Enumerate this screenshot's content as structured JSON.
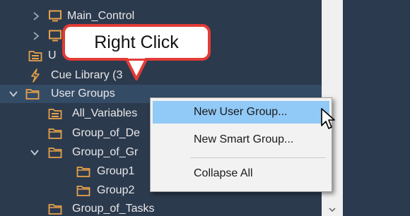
{
  "tree": {
    "items": [
      {
        "label": "Main_Control",
        "icon": "monitor-icon"
      },
      {
        "label": "",
        "icon": "monitor-icon"
      },
      {
        "label": "U",
        "icon": "variables-folder-icon"
      },
      {
        "label": "Cue Library (3",
        "icon": "lightning-icon"
      },
      {
        "label": "User Groups",
        "icon": "folder-icon"
      },
      {
        "label": "All_Variables",
        "icon": "variables-folder-icon"
      },
      {
        "label": "Group_of_De",
        "icon": "folder-icon"
      },
      {
        "label": "Group_of_Gr",
        "icon": "folder-icon"
      },
      {
        "label": "Group1",
        "icon": "folder-icon"
      },
      {
        "label": "Group2",
        "icon": "folder-icon"
      },
      {
        "label": "Group_of_Tasks",
        "icon": "folder-icon"
      }
    ]
  },
  "context_menu": {
    "items": [
      "New User Group...",
      "New Smart Group...",
      "Collapse All"
    ],
    "highlighted": "New User Group..."
  },
  "callout": {
    "text": "Right Click"
  },
  "colors": {
    "panel_bg": "#2c3a4e",
    "selected_row": "#344b66",
    "folder_orange": "#e8a24a",
    "menu_bg": "#f2f2f2",
    "menu_highlight": "#91c9f7",
    "callout_border": "#e23b36"
  }
}
